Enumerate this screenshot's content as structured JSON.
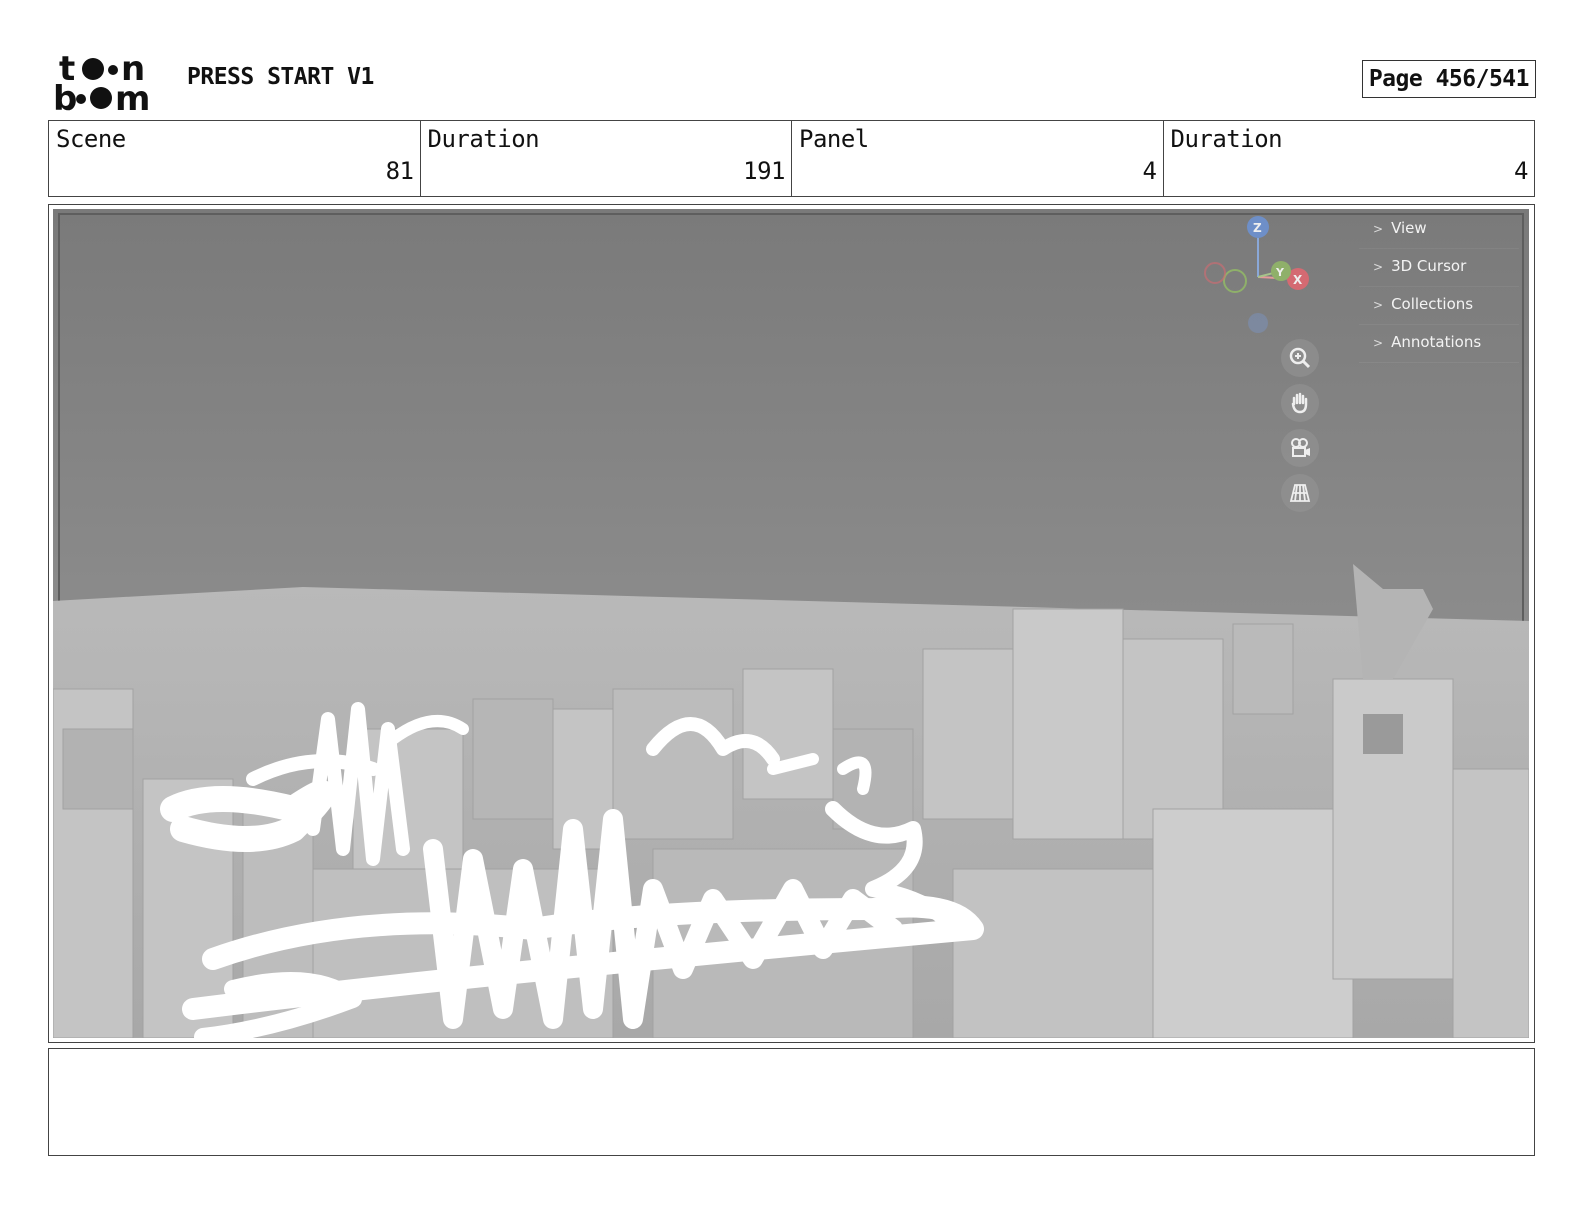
{
  "header": {
    "logo_text": "toon boom",
    "project_title": "PRESS START V1",
    "page_label": "Page 456/541"
  },
  "info": {
    "scene_label": "Scene",
    "scene_value": "81",
    "duration_label": "Duration",
    "duration_value": "191",
    "panel_label": "Panel",
    "panel_value": "4",
    "panel_duration_label": "Duration",
    "panel_duration_value": "4"
  },
  "viewport": {
    "gizmo_axes": [
      "Z",
      "Y",
      "X"
    ],
    "sidebar_items": [
      "View",
      "3D Cursor",
      "Collections",
      "Annotations"
    ],
    "nav_icons": [
      "zoom-icon",
      "hand-pan-icon",
      "camera-icon",
      "grid-icon"
    ]
  },
  "notes": {
    "text": ""
  }
}
